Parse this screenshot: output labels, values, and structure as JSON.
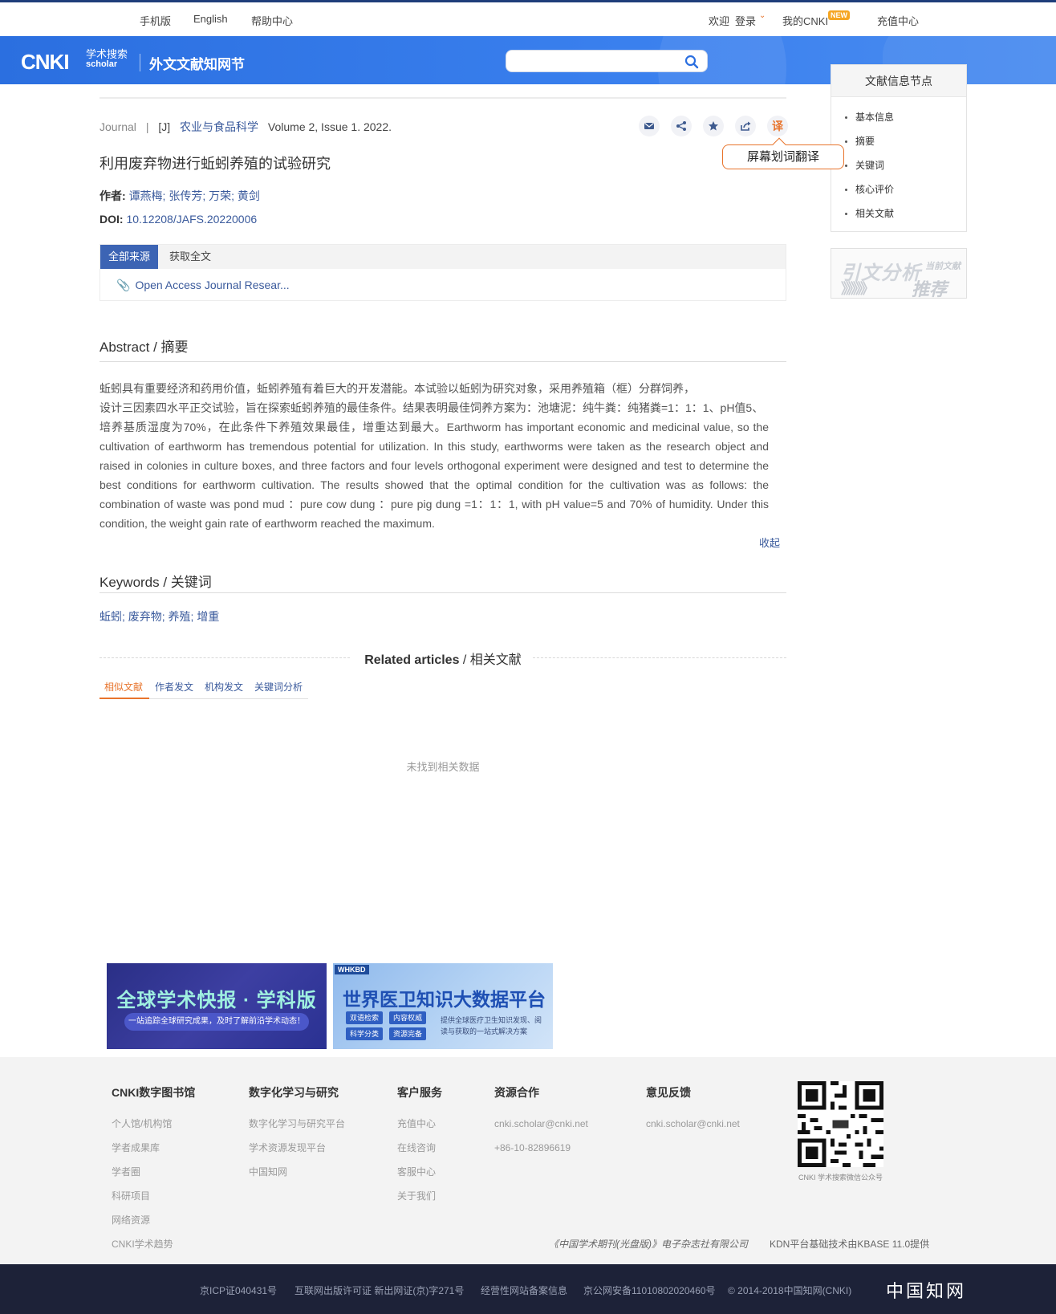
{
  "topbar": {
    "mobile": "手机版",
    "english": "English",
    "help": "帮助中心",
    "welcome": "欢迎",
    "login": "登录",
    "my_cnki": "我的CNKI",
    "new_badge": "NEW",
    "recharge": "充值中心"
  },
  "header": {
    "logo_main": "CNKI",
    "logo_cn": "学术搜索",
    "logo_en": "scholar",
    "node_title": "外文文献知网节",
    "search_placeholder": ""
  },
  "sidepanel": {
    "title": "文献信息节点",
    "items": [
      "基本信息",
      "摘要",
      "关键词",
      "核心评价",
      "相关文献"
    ]
  },
  "citation": {
    "title": "引文分析",
    "subtitle": "当前文献",
    "arrows": "》》》》》",
    "recommend": "推荐"
  },
  "article": {
    "type": "Journal",
    "sep": "|",
    "code": "[J]",
    "journal": "农业与食品科学",
    "volume": "Volume 2, Issue 1. 2022.",
    "translate_icon": "译",
    "tooltip": "屏幕划词翻译",
    "title": "利用废弃物进行蚯蚓养殖的试验研究",
    "authors_label": "作者:",
    "authors": "谭燕梅; 张传芳; 万荣; 黄剑",
    "doi_label": "DOI:",
    "doi": "10.12208/JAFS.20220006"
  },
  "sources": {
    "tab_all": "全部来源",
    "tab_full": "获取全文",
    "link": "Open Access Journal Resear..."
  },
  "abstract": {
    "heading": "Abstract / 摘要",
    "lines": [
      "蚯蚓具有重要经济和药用价值，蚯蚓养殖有着巨大的开发潜能。本试验以蚯蚓为研究对象，采用养殖箱（框）分群饲养，",
      "设计三因素四水平正交试验，旨在探索蚯蚓养殖的最佳条件。结果表明最佳饲养方案为：池塘泥：纯牛粪：纯猪粪=1：1：1、pH值5、",
      "培养基质湿度为70%，在此条件下养殖效果最佳，增重达到最大。Earthworm has important economic and medicinal value, so the cultivation of earthworm has tremendous potential for utilization. In this study, earthworms were taken as the research object and raised in colonies in culture boxes, and three factors and four levels orthogonal experiment were designed and test to determine the best conditions for earthworm cultivation. The results showed that the optimal condition for the cultivation was as follows: the combination of waste was pond mud ：pure cow dung ：pure pig dung =1：1：1, with pH value=5 and 70% of humidity. Under this condition, the weight gain rate of earthworm reached the maximum."
    ],
    "collapse": "收起"
  },
  "keywords": {
    "heading": "Keywords / 关键词",
    "list": "蚯蚓; 废弃物; 养殖; 增重"
  },
  "related": {
    "heading_en": "Related articles",
    "heading_cn": " / 相关文献",
    "tabs": [
      "相似文献",
      "作者发文",
      "机构发文",
      "关键词分析"
    ],
    "empty": "未找到相关数据"
  },
  "banners": {
    "b1_title": "全球学术快报 · 学科版",
    "b1_sub": "一站追踪全球研究成果，及时了解前沿学术动态！",
    "b2_tag": "WHKBD",
    "b2_title": "世界医卫知识大数据平台",
    "b2_pills": [
      "双语检索",
      "内容权威",
      "科学分类",
      "资源完备"
    ],
    "b2_desc": "提供全球医疗卫生知识发现、阅读与获取的一站式解决方案"
  },
  "footer": {
    "cols": [
      {
        "title": "CNKI数字图书馆",
        "items": [
          "个人馆/机构馆",
          "学者成果库",
          "学者圈",
          "科研项目",
          "网络资源",
          "CNKI学术趋势"
        ]
      },
      {
        "title": "数字化学习与研究",
        "items": [
          "数字化学习与研究平台",
          "学术资源发现平台",
          "中国知网"
        ]
      },
      {
        "title": "客户服务",
        "items": [
          "充值中心",
          "在线咨询",
          "客服中心",
          "关于我们"
        ]
      },
      {
        "title": "资源合作",
        "items": [
          "cnki.scholar@cnki.net",
          "+86-10-82896619"
        ]
      },
      {
        "title": "意见反馈",
        "items": [
          "cnki.scholar@cnki.net"
        ]
      }
    ],
    "qr_caption": "CNKI 学术搜索微信公众号",
    "publisher": "《中国学术期刊(光盘版)》电子杂志社有限公司",
    "tech": "KDN平台基础技术由KBASE 11.0提供"
  },
  "bottombar": {
    "icp": "京ICP证040431号",
    "publish": "互联网出版许可证 新出网证(京)字271号",
    "record": "经营性网站备案信息",
    "police": "京公网安备11010802020460号",
    "copyright": "© 2014-2018中国知网(CNKI)",
    "logo": "中国知网"
  },
  "colors": {
    "brand_blue": "#2b6fe0",
    "link_blue": "#3a5a9c",
    "accent_orange": "#e8742c",
    "dark_footer": "#1d2238"
  }
}
